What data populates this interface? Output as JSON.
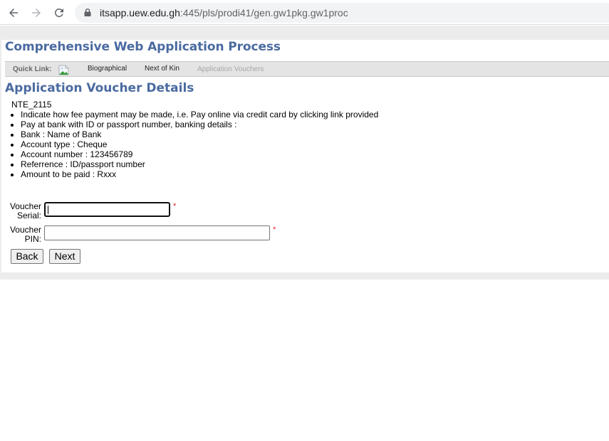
{
  "browser": {
    "url_host": "itsapp.uew.edu.gh",
    "url_rest": ":445/pls/prodi41/gen.gw1pkg.gw1proc",
    "icons": [
      "back-arrow-icon",
      "forward-arrow-icon",
      "reload-icon",
      "lock-icon"
    ]
  },
  "page": {
    "main_title": "Comprehensive Web Application Process",
    "quick_links": {
      "label": "Quick Link:",
      "image_icon": "broken-image-icon",
      "links": [
        {
          "label": "Biographical",
          "enabled": true
        },
        {
          "label": "Next of Kin",
          "enabled": true
        },
        {
          "label": "Application Vouchers",
          "enabled": false
        }
      ]
    },
    "section_title": "Application Voucher Details",
    "code": "NTE_2115",
    "instructions": [
      "Indicate how fee payment may be made, i.e.  Pay online via credit card by clicking link provided",
      "Pay at bank with ID or passport number, banking details :",
      "Bank : Name of Bank",
      "Account type : Cheque",
      "Account number : 123456789",
      "Referrence : ID/passport number",
      "Amount to be paid : Rxxx"
    ],
    "form": {
      "serial": {
        "label_line1": "Voucher",
        "label_line2": "Serial:",
        "value": "",
        "required_mark": "*"
      },
      "pin": {
        "label_line1": "Voucher",
        "label_line2": "PIN:",
        "value": "",
        "required_mark": "*"
      }
    },
    "buttons": {
      "back": "Back",
      "next": "Next"
    }
  }
}
